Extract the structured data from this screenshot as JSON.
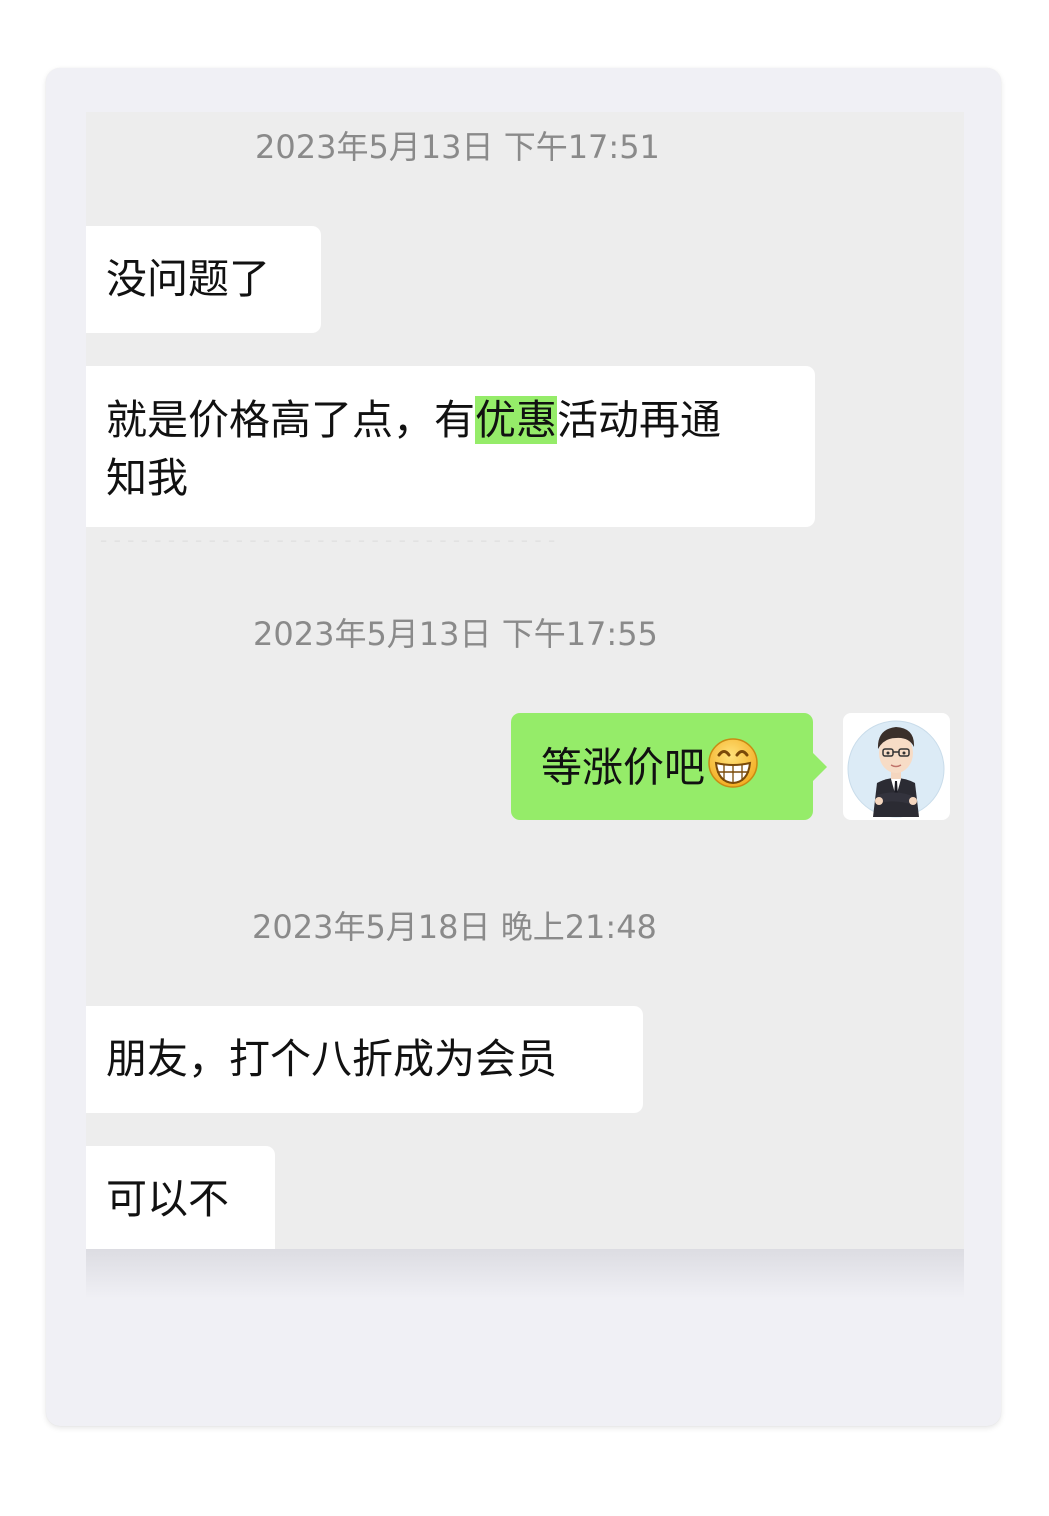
{
  "messages": [
    {
      "type": "timestamp",
      "text": "2023年5月13日 下午17:51"
    },
    {
      "type": "incoming",
      "text": "没问题了"
    },
    {
      "type": "incoming",
      "before": "就是价格高了点，有",
      "highlight": "优惠",
      "after": "活动再通",
      "line2": "知我"
    },
    {
      "type": "timestamp",
      "text": "2023年5月13日 下午17:55"
    },
    {
      "type": "outgoing",
      "text": "等涨价吧",
      "emoji": "grin-emoji"
    },
    {
      "type": "timestamp",
      "text": "2023年5月18日 晚上21:48"
    },
    {
      "type": "incoming",
      "text": "朋友，打个八折成为会员"
    },
    {
      "type": "incoming",
      "text": "可以不"
    }
  ],
  "colors": {
    "chat_background": "#ededed",
    "card_background": "#f0f0f5",
    "incoming_bubble": "#ffffff",
    "outgoing_bubble": "#95ec69",
    "highlight": "#95ec69",
    "timestamp_text": "#8a8a8a"
  },
  "icons": {
    "avatar": "avatar-cartoon-man-suit",
    "emoji": "grin-emoji"
  }
}
